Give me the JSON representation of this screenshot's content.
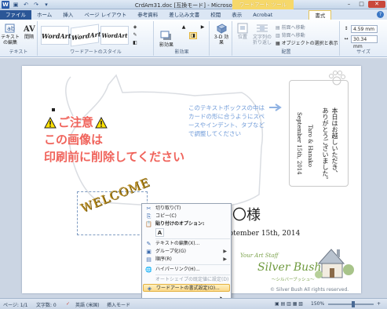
{
  "window": {
    "title": "CrdAm31.doc [互換モード] - Microsoft Word",
    "context_tab_title": "ワードアート ツール",
    "word_logo": "W"
  },
  "tabs": [
    "ファイル",
    "ホーム",
    "挿入",
    "ページ レイアウト",
    "参考資料",
    "差し込み文書",
    "校閲",
    "表示",
    "Acrobat",
    "書式"
  ],
  "ribbon": {
    "text_group": {
      "label": "テキスト",
      "edit_text": "テキストの編集",
      "spacing": "間隔"
    },
    "wordart_styles": {
      "label": "ワードアートのスタイル",
      "samples": [
        "WordArt",
        "WordArt",
        "WordArt"
      ]
    },
    "shadow_effects": {
      "label": "影効果",
      "shadow_button": "影効果"
    },
    "three_d": {
      "label": "",
      "button": "3-D 効果"
    },
    "arrange": {
      "label": "配置",
      "position": "位置",
      "wrap": "文字列の折り返し",
      "bring_forward": "前面へ移動",
      "send_backward": "背面へ移動",
      "selection_pane": "オブジェクトの選択と表示"
    },
    "size": {
      "label": "サイズ",
      "height": "4.59 mm",
      "width": "30.34 mm"
    }
  },
  "document": {
    "caution_line1": "ご注意",
    "caution_line2": "この画像は",
    "caution_line3": "印刷前に削除してください",
    "note_text": "このテキストボックスの中はカードの形に合うようにスペースやインデント、タブなどで調整してください",
    "vertical_col1": "本日はお越しいただき、",
    "vertical_col2": "ありがとうございました。",
    "vertical_col3": "Taro & Hanako",
    "vertical_col4": "September 15th, 2014",
    "welcome": "WELCOME",
    "name_line": "〇〇様",
    "date_line": "eptember 15th, 2014",
    "logo_staff": "Your Art Staff",
    "logo_brand": "Silver Bush",
    "logo_sub": "～シルバーブッシュ～",
    "copyright": "© Silver Bush   All rights reserved."
  },
  "context_menu": {
    "cut": "切り取り(T)",
    "copy": "コピー(C)",
    "paste_options": "貼り付けのオプション:",
    "paste_a": "A",
    "edit_text": "テキストの編集(X)...",
    "group": "グループ化(G)",
    "order": "順序(R)",
    "hyperlink": "ハイパーリンク(H)...",
    "set_default": "オートシェイプの既定値に設定(D)",
    "format_wordart": "ワードアートの書式設定(O)..."
  },
  "statusbar": {
    "page": "ページ: 1/1",
    "words": "文字数: 0",
    "language": "英語 (米国)",
    "insert_mode": "挿入モード",
    "zoom": "150%"
  },
  "colors": {
    "accent": "#2b5797",
    "caution": "#f0645c",
    "note": "#6e9ad8",
    "wordart_gold": "#b88b1c",
    "brand_green": "#6f9a3e"
  }
}
